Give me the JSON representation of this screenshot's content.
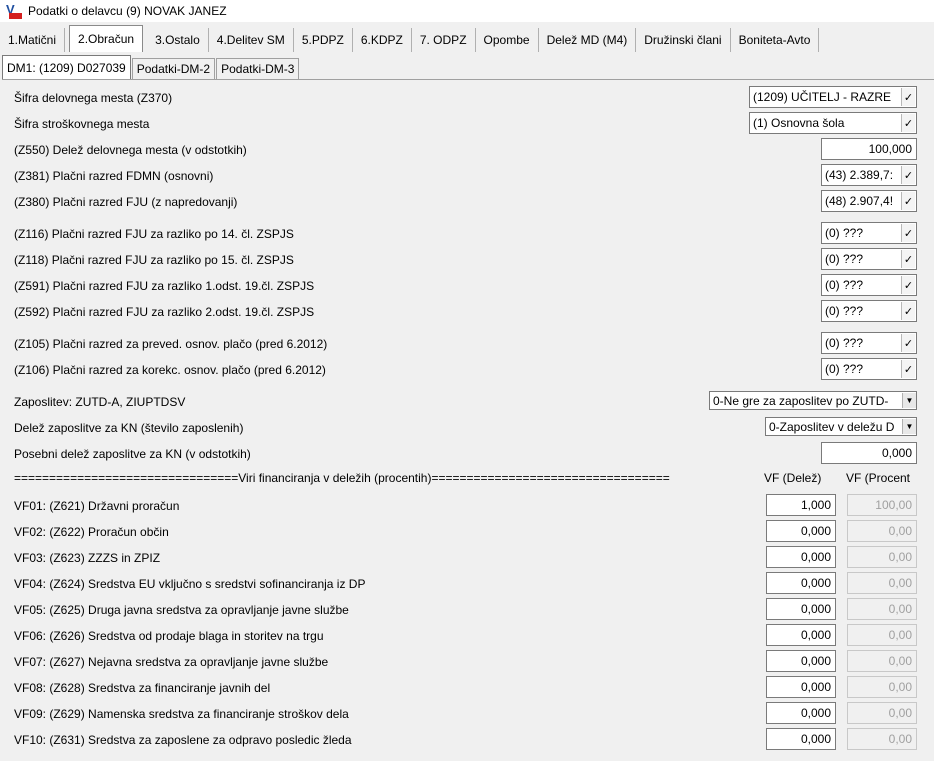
{
  "window": {
    "title": "Podatki o delavcu (9) NOVAK JANEZ"
  },
  "main_tabs": [
    {
      "label": "1.Matični",
      "active": false
    },
    {
      "label": "2.Obračun",
      "active": true
    },
    {
      "label": "3.Ostalo",
      "active": false
    },
    {
      "label": "4.Delitev SM",
      "active": false
    },
    {
      "label": "5.PDPZ",
      "active": false
    },
    {
      "label": "6.KDPZ",
      "active": false
    },
    {
      "label": "7. ODPZ",
      "active": false
    },
    {
      "label": "Opombe",
      "active": false
    },
    {
      "label": "Delež MD (M4)",
      "active": false
    },
    {
      "label": "Družinski člani",
      "active": false
    },
    {
      "label": "Boniteta-Avto",
      "active": false
    }
  ],
  "sub_tabs": [
    {
      "label": "DM1: (1209) D027039",
      "active": true
    },
    {
      "label": "Podatki-DM-2",
      "active": false
    },
    {
      "label": "Podatki-DM-3",
      "active": false
    }
  ],
  "fields": {
    "z370": {
      "label": "Šifra delovnega mesta (Z370)",
      "value": "(1209) UČITELJ - RAZRE"
    },
    "stroskovno": {
      "label": "Šifra stroškovnega mesta",
      "value": "(1) Osnovna šola"
    },
    "z550": {
      "label": "(Z550) Delež delovnega mesta (v odstotkih)",
      "value": "100,000"
    },
    "z381": {
      "label": "(Z381) Plačni razred FDMN (osnovni)",
      "value": "(43) 2.389,7:"
    },
    "z380": {
      "label": "(Z380) Plačni razred FJU (z napredovanji)",
      "value": "(48) 2.907,4!"
    },
    "z116": {
      "label": "(Z116) Plačni razred FJU za razliko po 14. čl. ZSPJS",
      "value": "(0) ???"
    },
    "z118": {
      "label": "(Z118) Plačni razred FJU za razliko po 15. čl. ZSPJS",
      "value": "(0) ???"
    },
    "z591": {
      "label": "(Z591) Plačni razred FJU za razliko 1.odst. 19.čl. ZSPJS",
      "value": "(0) ???"
    },
    "z592": {
      "label": "(Z592) Plačni razred FJU za razliko 2.odst. 19.čl. ZSPJS",
      "value": "(0) ???"
    },
    "z105": {
      "label": "(Z105) Plačni razred za preved. osnov. plačo (pred 6.2012)",
      "value": "(0) ???"
    },
    "z106": {
      "label": "(Z106) Plačni razred za korekc. osnov. plačo (pred 6.2012)",
      "value": "(0) ???"
    },
    "zaposlitev": {
      "label": "Zaposlitev: ZUTD-A, ZIUPTDSV",
      "value": "0-Ne gre za zaposlitev po ZUTD-"
    },
    "delez_kn": {
      "label": "Delež zaposlitve za KN (število zaposlenih)",
      "value": "0-Zaposlitev v deležu D"
    },
    "posebni_kn": {
      "label": "Posebni delež zaposlitve za KN (v odstotkih)",
      "value": "0,000"
    }
  },
  "vf_header": {
    "separator": "================================Viri financiranja v deležih (procentih)==================================",
    "col_delez": "VF (Delež)",
    "col_procent": "VF (Procent"
  },
  "vf_rows": [
    {
      "label": "VF01: (Z621) Državni proračun",
      "delez": "1,000",
      "procent": "100,00"
    },
    {
      "label": "VF02: (Z622) Proračun občin",
      "delez": "0,000",
      "procent": "0,00"
    },
    {
      "label": "VF03: (Z623) ZZZS in ZPIZ",
      "delez": "0,000",
      "procent": "0,00"
    },
    {
      "label": "VF04: (Z624) Sredstva EU vključno s sredstvi sofinanciranja iz DP",
      "delez": "0,000",
      "procent": "0,00"
    },
    {
      "label": "VF05: (Z625) Druga javna sredstva za opravljanje javne službe",
      "delez": "0,000",
      "procent": "0,00"
    },
    {
      "label": "VF06: (Z626) Sredstva od prodaje blaga in storitev na trgu",
      "delez": "0,000",
      "procent": "0,00"
    },
    {
      "label": "VF07: (Z627) Nejavna sredstva za opravljanje javne službe",
      "delez": "0,000",
      "procent": "0,00"
    },
    {
      "label": "VF08: (Z628) Sredstva za financiranje javnih del",
      "delez": "0,000",
      "procent": "0,00"
    },
    {
      "label": "VF09: (Z629) Namenska sredstva za financiranje stroškov dela",
      "delez": "0,000",
      "procent": "0,00"
    },
    {
      "label": "VF10: (Z631) Sredstva za zaposlene za odpravo posledic žleda",
      "delez": "0,000",
      "procent": "0,00"
    }
  ],
  "icons": {
    "app": "app-logo-icon",
    "combo_button": "checkmark-icon",
    "dropdown": "chevron-down-icon"
  }
}
